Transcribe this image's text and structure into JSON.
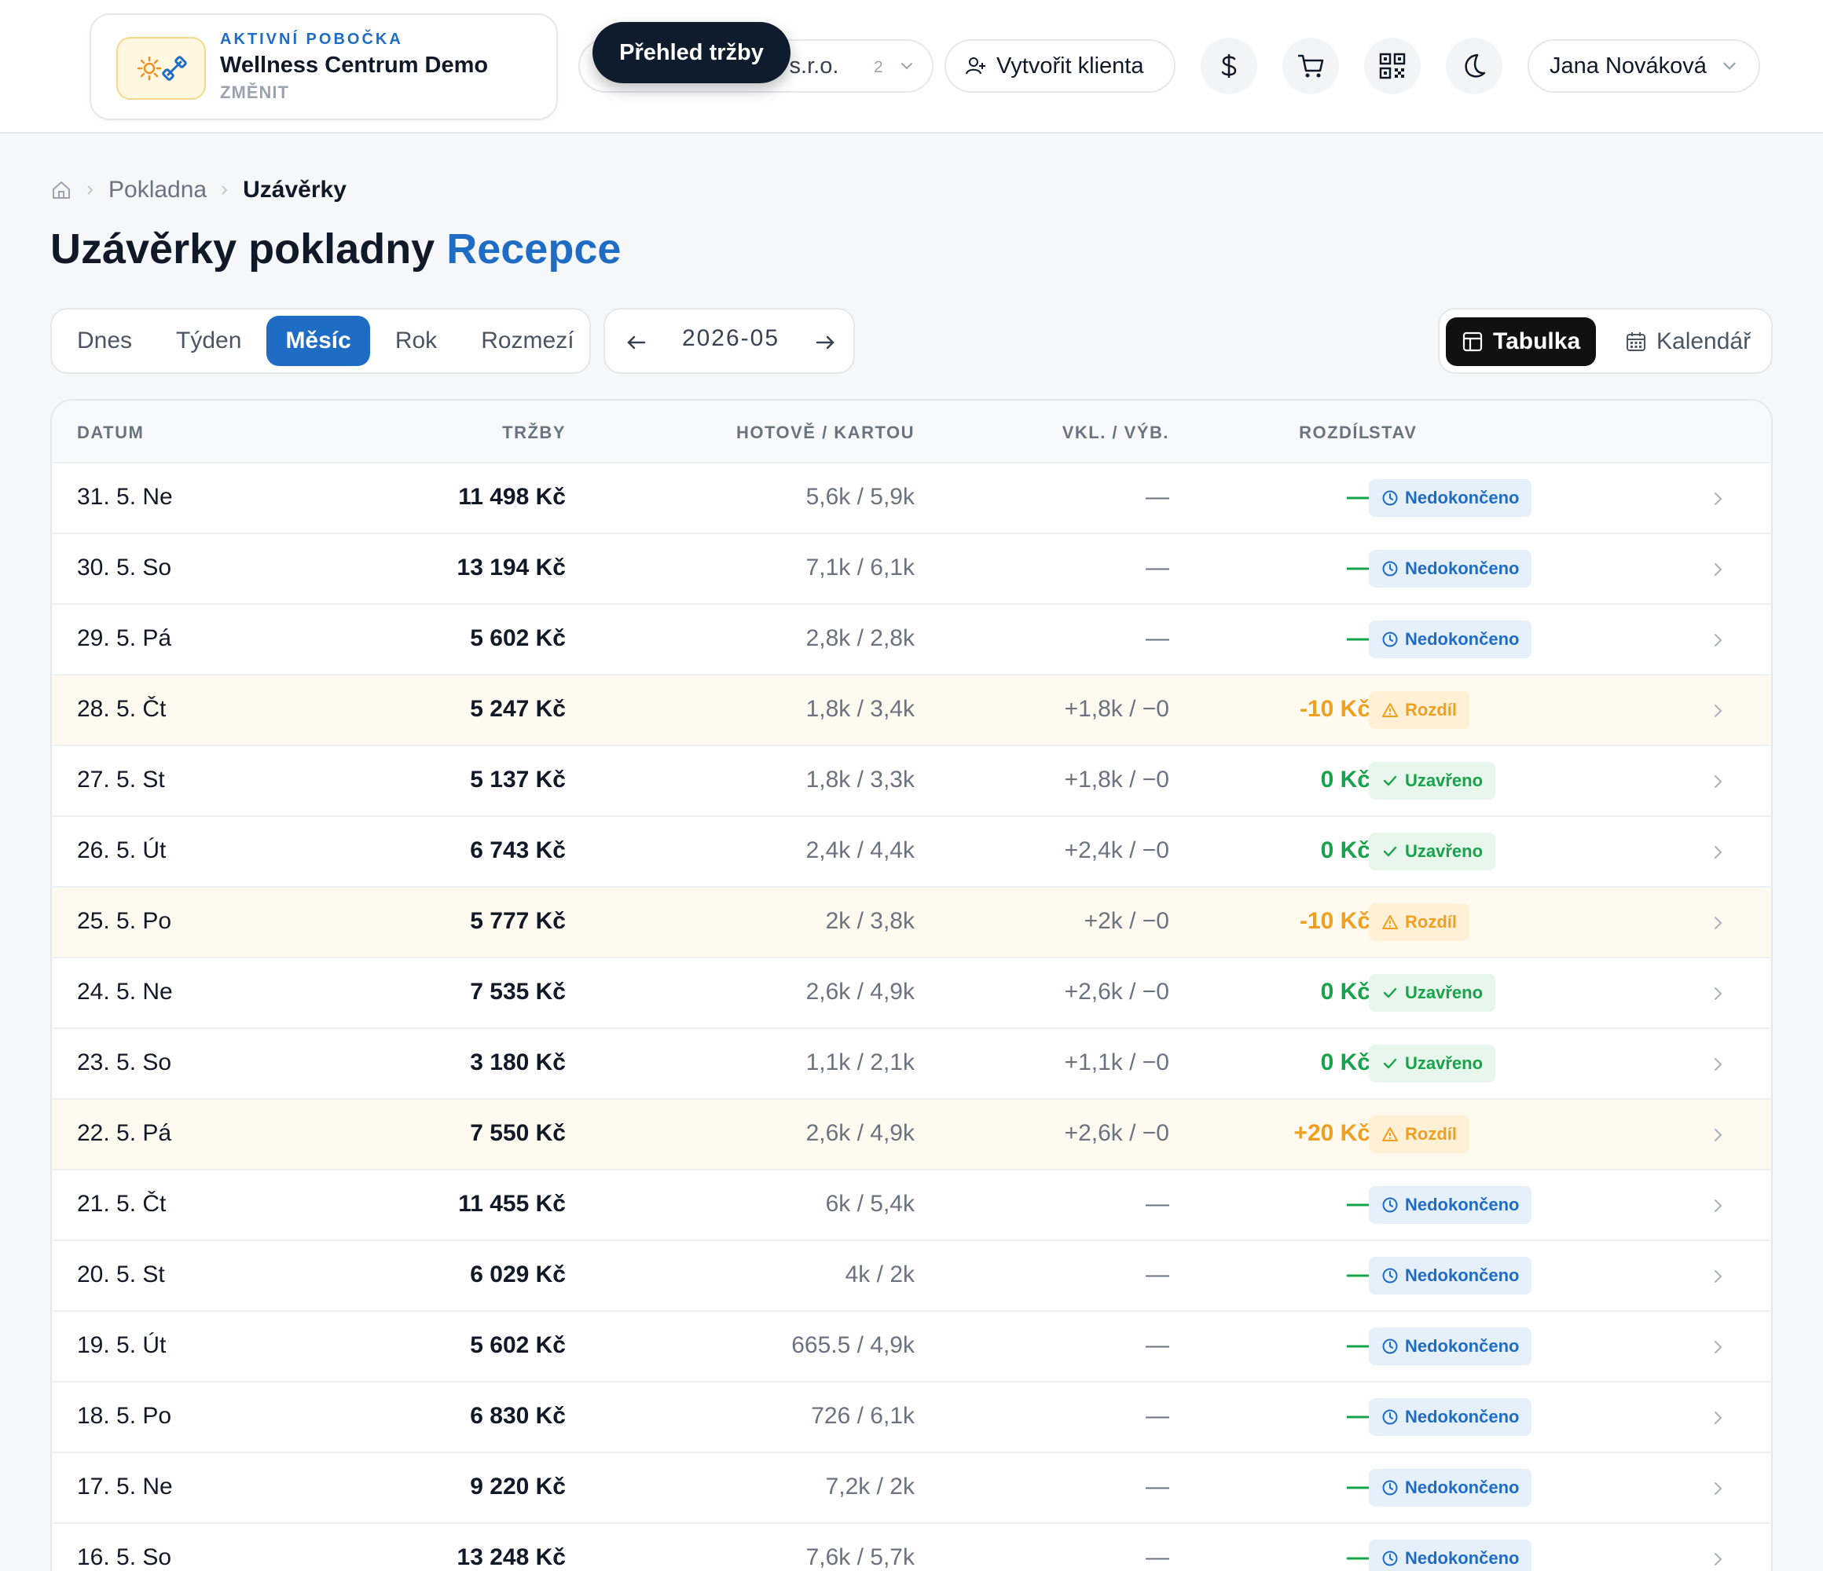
{
  "header": {
    "branch_label": "AKTIVNÍ POBOČKA",
    "branch_name": "Wellness Centrum Demo",
    "branch_change": "ZMĚNIT",
    "company_text": "s s.r.o.",
    "company_count": "2",
    "tooltip": "Přehled tržby",
    "create_client": "Vytvořit klienta",
    "user_name": "Jana Nováková"
  },
  "breadcrumb": {
    "section": "Pokladna",
    "current": "Uzávěrky"
  },
  "title": {
    "main": "Uzávěrky pokladny",
    "accent": "Recepce"
  },
  "period_tabs": [
    "Dnes",
    "Týden",
    "Měsíc",
    "Rok",
    "Rozmezí"
  ],
  "active_period": "Měsíc",
  "month": "2026-05",
  "views": {
    "table": "Tabulka",
    "calendar": "Kalendář",
    "active": "table"
  },
  "columns": {
    "date": "DATUM",
    "revenue": "TRŽBY",
    "split": "HOTOVĚ / KARTOU",
    "deposit": "VKL. / VÝB.",
    "diff": "ROZDÍL",
    "status": "STAV"
  },
  "colors": {
    "accent": "#1f6cc4",
    "ok": "#16a34a",
    "warn": "#f0a020",
    "dark": "#0f1c2e"
  },
  "rows": [
    {
      "date": "31. 5. Ne",
      "revenue": "11 498 Kč",
      "split": "5,6k / 5,9k",
      "deposit": "—",
      "diff": "—",
      "status": "Nedokončeno",
      "kind": "open"
    },
    {
      "date": "30. 5. So",
      "revenue": "13 194 Kč",
      "split": "7,1k / 6,1k",
      "deposit": "—",
      "diff": "—",
      "status": "Nedokončeno",
      "kind": "open"
    },
    {
      "date": "29. 5. Pá",
      "revenue": "5 602 Kč",
      "split": "2,8k / 2,8k",
      "deposit": "—",
      "diff": "—",
      "status": "Nedokončeno",
      "kind": "open"
    },
    {
      "date": "28. 5. Čt",
      "revenue": "5 247 Kč",
      "split": "1,8k / 3,4k",
      "deposit": "+1,8k / −0",
      "diff": "-10 Kč",
      "status": "Rozdíl",
      "kind": "diff"
    },
    {
      "date": "27. 5. St",
      "revenue": "5 137 Kč",
      "split": "1,8k / 3,3k",
      "deposit": "+1,8k / −0",
      "diff": "0 Kč",
      "status": "Uzavřeno",
      "kind": "closed"
    },
    {
      "date": "26. 5. Út",
      "revenue": "6 743 Kč",
      "split": "2,4k / 4,4k",
      "deposit": "+2,4k / −0",
      "diff": "0 Kč",
      "status": "Uzavřeno",
      "kind": "closed"
    },
    {
      "date": "25. 5. Po",
      "revenue": "5 777 Kč",
      "split": "2k / 3,8k",
      "deposit": "+2k / −0",
      "diff": "-10 Kč",
      "status": "Rozdíl",
      "kind": "diff"
    },
    {
      "date": "24. 5. Ne",
      "revenue": "7 535 Kč",
      "split": "2,6k / 4,9k",
      "deposit": "+2,6k / −0",
      "diff": "0 Kč",
      "status": "Uzavřeno",
      "kind": "closed"
    },
    {
      "date": "23. 5. So",
      "revenue": "3 180 Kč",
      "split": "1,1k / 2,1k",
      "deposit": "+1,1k / −0",
      "diff": "0 Kč",
      "status": "Uzavřeno",
      "kind": "closed"
    },
    {
      "date": "22. 5. Pá",
      "revenue": "7 550 Kč",
      "split": "2,6k / 4,9k",
      "deposit": "+2,6k / −0",
      "diff": "+20 Kč",
      "status": "Rozdíl",
      "kind": "diff"
    },
    {
      "date": "21. 5. Čt",
      "revenue": "11 455 Kč",
      "split": "6k / 5,4k",
      "deposit": "—",
      "diff": "—",
      "status": "Nedokončeno",
      "kind": "open"
    },
    {
      "date": "20. 5. St",
      "revenue": "6 029 Kč",
      "split": "4k / 2k",
      "deposit": "—",
      "diff": "—",
      "status": "Nedokončeno",
      "kind": "open"
    },
    {
      "date": "19. 5. Út",
      "revenue": "5 602 Kč",
      "split": "665.5 / 4,9k",
      "deposit": "—",
      "diff": "—",
      "status": "Nedokončeno",
      "kind": "open"
    },
    {
      "date": "18. 5. Po",
      "revenue": "6 830 Kč",
      "split": "726 / 6,1k",
      "deposit": "—",
      "diff": "—",
      "status": "Nedokončeno",
      "kind": "open"
    },
    {
      "date": "17. 5. Ne",
      "revenue": "9 220 Kč",
      "split": "7,2k / 2k",
      "deposit": "—",
      "diff": "—",
      "status": "Nedokončeno",
      "kind": "open"
    },
    {
      "date": "16. 5. So",
      "revenue": "13 248 Kč",
      "split": "7,6k / 5,7k",
      "deposit": "—",
      "diff": "—",
      "status": "Nedokončeno",
      "kind": "open"
    }
  ]
}
